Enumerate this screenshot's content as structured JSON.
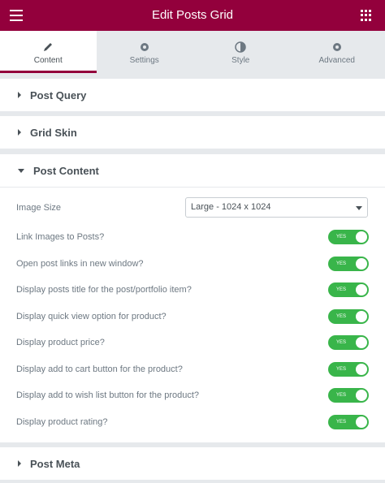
{
  "topbar": {
    "title": "Edit Posts Grid"
  },
  "tabs": [
    {
      "label": "Content",
      "icon": "pencil-icon",
      "active": true
    },
    {
      "label": "Settings",
      "icon": "gear-icon",
      "active": false
    },
    {
      "label": "Style",
      "icon": "half-circle-icon",
      "active": false
    },
    {
      "label": "Advanced",
      "icon": "gear-icon",
      "active": false
    }
  ],
  "sections": {
    "post_query": "Post Query",
    "grid_skin": "Grid Skin",
    "post_content": "Post Content",
    "post_meta": "Post Meta"
  },
  "image_size": {
    "label": "Image Size",
    "value": "Large - 1024 x 1024"
  },
  "toggles": [
    {
      "label": "Link Images to Posts?",
      "state": "YES"
    },
    {
      "label": "Open post links in new window?",
      "state": "YES"
    },
    {
      "label": "Display posts title for the post/portfolio item?",
      "state": "YES"
    },
    {
      "label": "Display quick view option for product?",
      "state": "YES"
    },
    {
      "label": "Display product price?",
      "state": "YES"
    },
    {
      "label": "Display add to cart button for the product?",
      "state": "YES"
    },
    {
      "label": "Display add to wish list button for the product?",
      "state": "YES"
    },
    {
      "label": "Display product rating?",
      "state": "YES"
    }
  ]
}
